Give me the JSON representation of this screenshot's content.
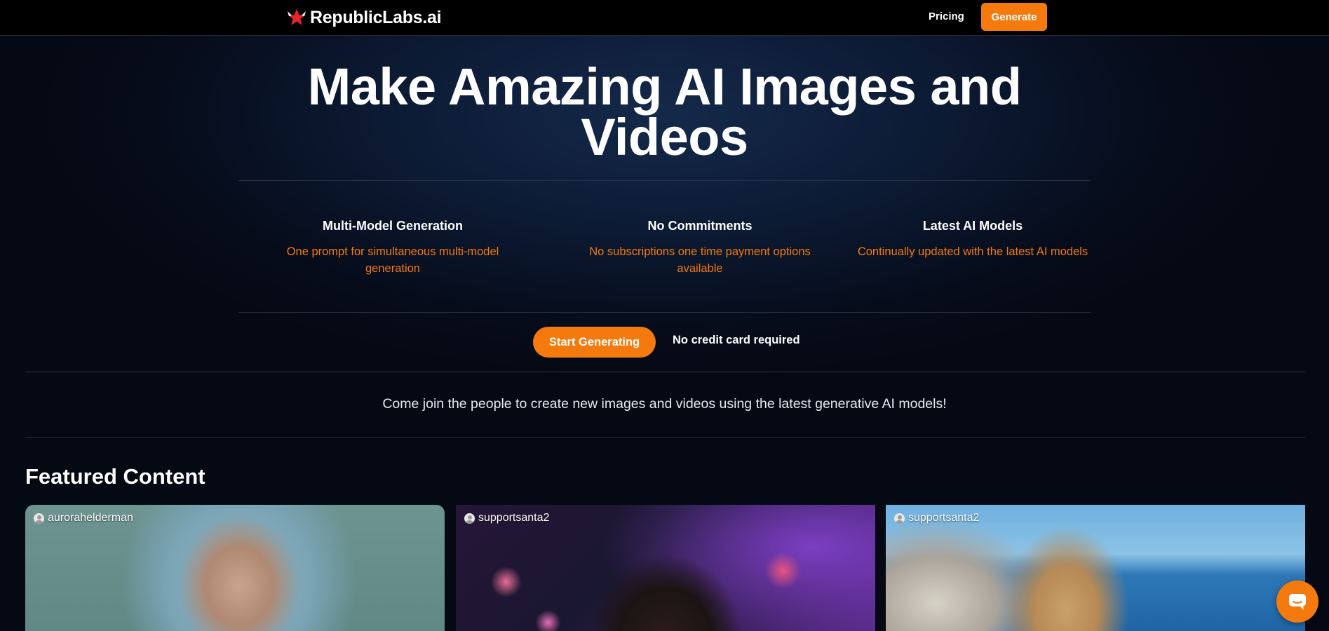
{
  "header": {
    "logo_text": "RepublicLabs.ai",
    "nav": {
      "pricing_label": "Pricing",
      "generate_label": "Generate"
    }
  },
  "hero": {
    "title_line1": "Make Amazing AI Images and",
    "title_line2": "Videos"
  },
  "features": [
    {
      "title": "Multi-Model Generation",
      "description": "One prompt for simultaneous multi-model generation"
    },
    {
      "title": "No Commitments",
      "description": "No subscriptions one time payment options available"
    },
    {
      "title": "Latest AI Models",
      "description": "Continually updated with the latest AI models"
    }
  ],
  "cta": {
    "button_label": "Start Generating",
    "note": "No credit card required"
  },
  "join_text": "Come join the people to create new images and videos using the latest generative AI models!",
  "featured": {
    "title": "Featured Content",
    "cards": [
      {
        "username": "aurorahelderman"
      },
      {
        "username": "supportsanta2"
      },
      {
        "username": "supportsanta2"
      }
    ]
  },
  "icons": {
    "logo": "republiclabs-logo-icon",
    "avatar": "user-avatar-icon",
    "chat": "chat-bubble-icon"
  },
  "colors": {
    "accent": "#f57a0e",
    "background": "#050913",
    "header": "#000000"
  }
}
